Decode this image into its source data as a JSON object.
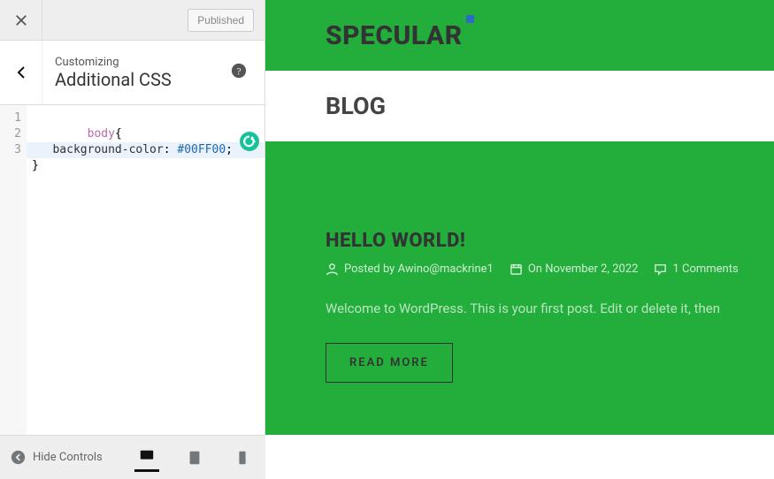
{
  "topbar": {
    "publish_label": "Published"
  },
  "section": {
    "sub": "Customizing",
    "main": "Additional CSS"
  },
  "code": {
    "lines": [
      "1",
      "2",
      "3"
    ],
    "line1_selector": "body",
    "line1_brace": "{",
    "line2_indent": "   ",
    "line2_prop": "background-color",
    "line2_colon": ": ",
    "line2_value": "#00FF00",
    "line2_semi": ";",
    "line3": "}"
  },
  "preview": {
    "brand": "SPECULAR",
    "blog": "BLOG",
    "post_title": "HELLO WORLD!",
    "posted_by_prefix": "Posted by ",
    "author": "Awino@mackrine1",
    "on_prefix": "On ",
    "date": "November 2, 2022",
    "comments": "1 Comments",
    "excerpt": "Welcome to WordPress. This is your first post. Edit or delete it, then",
    "read_more": "READ MORE"
  },
  "footer": {
    "hide_controls": "Hide Controls"
  }
}
